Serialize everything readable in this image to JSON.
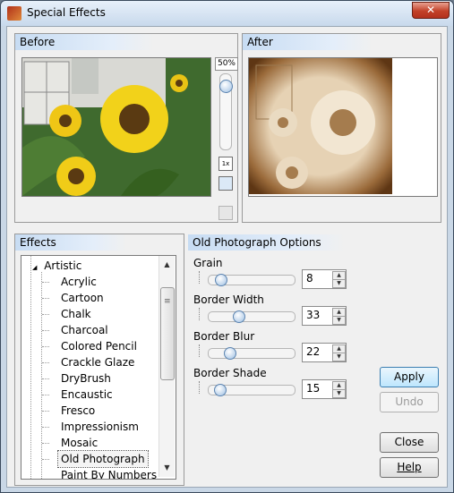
{
  "window": {
    "title": "Special Effects",
    "close_glyph": "✕"
  },
  "before_panel": {
    "title": "Before"
  },
  "after_panel": {
    "title": "After"
  },
  "zoom": {
    "label": "50%",
    "fit_icon": "1x"
  },
  "effects_panel": {
    "title": "Effects"
  },
  "tree": {
    "category": "Artistic",
    "expand_glyph": "◢",
    "items": [
      "Acrylic",
      "Cartoon",
      "Chalk",
      "Charcoal",
      "Colored Pencil",
      "Crackle Glaze",
      "DryBrush",
      "Encaustic",
      "Fresco",
      "Impressionism",
      "Mosaic",
      "Old Photograph",
      "Paint By Numbers"
    ],
    "selected": "Old Photograph"
  },
  "options_panel": {
    "title": "Old Photograph Options",
    "settings": [
      {
        "label": "Grain",
        "value": "8",
        "level": 0.1
      },
      {
        "label": "Border Width",
        "value": "33",
        "level": 0.33
      },
      {
        "label": "Border Blur",
        "value": "22",
        "level": 0.22
      },
      {
        "label": "Border Shade",
        "value": "15",
        "level": 0.08
      }
    ]
  },
  "buttons": {
    "apply": "Apply",
    "undo": "Undo",
    "close": "Close",
    "help": "Help"
  },
  "icons": {
    "up": "▲",
    "down": "▼",
    "spin_up": "▲",
    "spin_down": "▼"
  },
  "colors": {
    "title_accent": "#c7dcf3",
    "sepia": "#8b5a2b",
    "sunflower": "#f2d21a"
  }
}
